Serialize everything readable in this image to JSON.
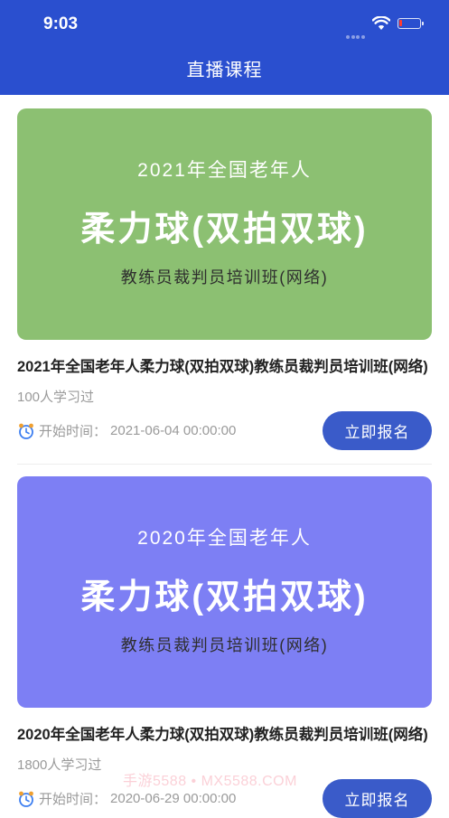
{
  "status_bar": {
    "time": "9:03"
  },
  "nav": {
    "title": "直播课程"
  },
  "courses": [
    {
      "banner_color": "#8cc072",
      "banner_line1": "2021年全国老年人",
      "banner_line2": "柔力球(双拍双球)",
      "banner_line3": "教练员裁判员培训班(网络)",
      "title": "2021年全国老年人柔力球(双拍双球)教练员裁判员培训班(网络)",
      "learners": "100人学习过",
      "start_label": "开始时间：",
      "start_time": "2021-06-04 00:00:00",
      "button_label": "立即报名"
    },
    {
      "banner_color": "#7d7ff4",
      "banner_line1": "2020年全国老年人",
      "banner_line2": "柔力球(双拍双球)",
      "banner_line3": "教练员裁判员培训班(网络)",
      "title": "2020年全国老年人柔力球(双拍双球)教练员裁判员培训班(网络)",
      "learners": "1800人学习过",
      "start_label": "开始时间：",
      "start_time": "2020-06-29 00:00:00",
      "button_label": "立即报名"
    }
  ],
  "watermark": "手游5588 • MX5588.COM"
}
